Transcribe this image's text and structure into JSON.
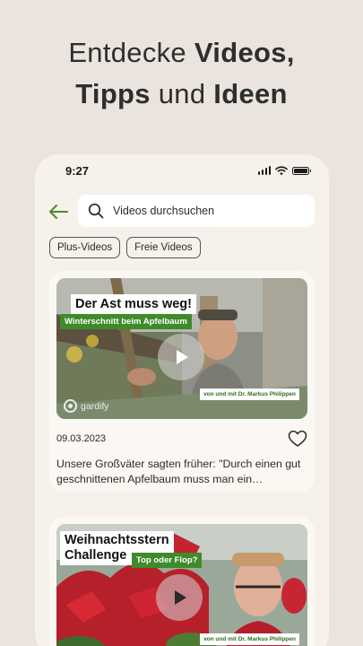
{
  "headline": {
    "part1": "Entdecke ",
    "bold1": "Videos,",
    "bold2": "Tipps",
    "part2": " und ",
    "bold3": "Ideen"
  },
  "status_bar": {
    "time": "9:27"
  },
  "search": {
    "placeholder": "Videos durchsuchen"
  },
  "filters": [
    "Plus-Videos",
    "Freie Videos"
  ],
  "videos": [
    {
      "title": "Der Ast muss weg!",
      "subtitle": "Winterschnitt beim Apfelbaum",
      "credit": "von und mit Dr. Markus Philippen",
      "brand": "gardify",
      "date": "09.03.2023",
      "description": "Unsere Großväter sagten früher: \"Durch einen gut geschnittenen Apfelbaum muss man ein…"
    },
    {
      "title_line1": "Weihnachtsstern",
      "title_line2": "Challenge",
      "subtitle": "Top oder Flop?",
      "credit": "von und mit Dr. Markus Philippen"
    }
  ],
  "colors": {
    "accent_green": "#3f8a2a",
    "background": "#ebe4de",
    "card": "#fbf8f3"
  },
  "icons": [
    "back-arrow-icon",
    "search-icon",
    "play-icon",
    "heart-icon",
    "signal-icon",
    "wifi-icon",
    "battery-icon"
  ]
}
